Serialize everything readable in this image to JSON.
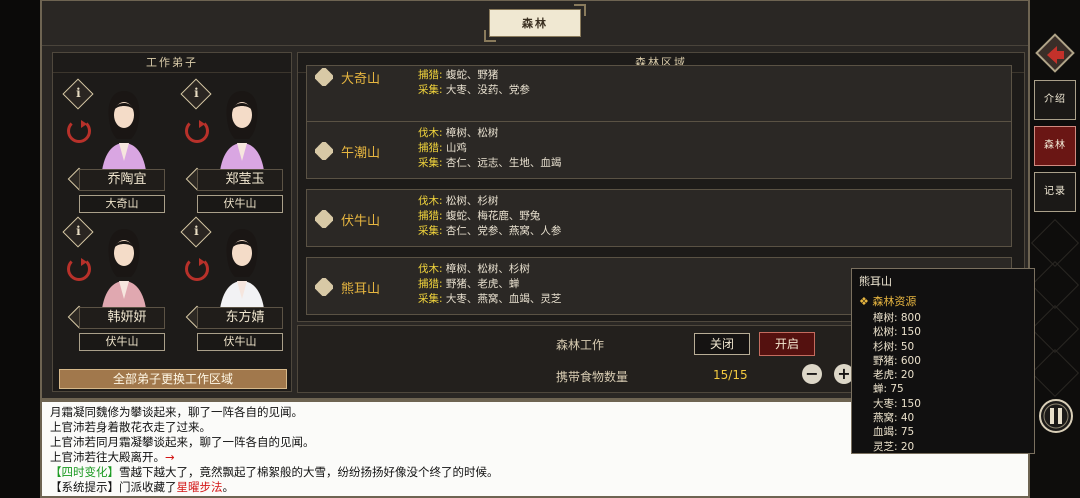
{
  "window": {
    "title": "森林"
  },
  "left_panel": {
    "header": "工作弟子",
    "characters": [
      {
        "name": "乔陶宜",
        "region": "大奇山"
      },
      {
        "name": "郑莹玉",
        "region": "伏牛山"
      },
      {
        "name": "韩妍妍",
        "region": "伏牛山"
      },
      {
        "name": "东方婧",
        "region": "伏牛山"
      }
    ],
    "all_button": "全部弟子更换工作区域"
  },
  "right_panel": {
    "header": "森林区域",
    "areas": [
      {
        "name": "大奇山",
        "rows": [
          {
            "key": "捕猎:",
            "value": "蝮蛇、野猪"
          },
          {
            "key": "采集:",
            "value": "大枣、没药、党参"
          }
        ]
      },
      {
        "name": "午潮山",
        "rows": [
          {
            "key": "伐木:",
            "value": "樟树、松树"
          },
          {
            "key": "捕猎:",
            "value": "山鸡"
          },
          {
            "key": "采集:",
            "value": "杏仁、远志、生地、血竭"
          }
        ]
      },
      {
        "name": "伏牛山",
        "rows": [
          {
            "key": "伐木:",
            "value": "松树、杉树"
          },
          {
            "key": "捕猎:",
            "value": "蝮蛇、梅花鹿、野兔"
          },
          {
            "key": "采集:",
            "value": "杏仁、党参、燕窝、人参"
          }
        ]
      },
      {
        "name": "熊耳山",
        "rows": [
          {
            "key": "伐木:",
            "value": "樟树、松树、杉树"
          },
          {
            "key": "捕猎:",
            "value": "野猪、老虎、蝉"
          },
          {
            "key": "采集:",
            "value": "大枣、燕窝、血竭、灵芝"
          }
        ]
      }
    ]
  },
  "work": {
    "label": "森林工作",
    "close": "关闭",
    "open": "开启",
    "food_label": "携带食物数量",
    "food_count": "15/15",
    "minus": "−",
    "plus": "+"
  },
  "log": [
    {
      "parts": [
        {
          "t": "月霜凝同魏修为攀谈起来，聊了一阵各自的见闻。",
          "c": ""
        }
      ]
    },
    {
      "parts": [
        {
          "t": "上官沛若身着散花衣走了过来。",
          "c": ""
        }
      ]
    },
    {
      "parts": [
        {
          "t": "上官沛若同月霜凝攀谈起来，聊了一阵各自的见闻。",
          "c": ""
        }
      ]
    },
    {
      "parts": [
        {
          "t": "上官沛若往大殿离开。",
          "c": ""
        },
        {
          "t": "→",
          "c": "r"
        }
      ]
    },
    {
      "parts": [
        {
          "t": "【四时变化】",
          "c": "g"
        },
        {
          "t": "雪越下越大了，竟然飘起了棉絮般的大雪，纷纷扬扬好像没个终了的时候。",
          "c": ""
        }
      ]
    },
    {
      "parts": [
        {
          "t": "【系统提示】门派收藏了",
          "c": ""
        },
        {
          "t": "星曜步法",
          "c": "r"
        },
        {
          "t": "。",
          "c": ""
        }
      ]
    }
  ],
  "sidebar": {
    "tabs": [
      "介绍",
      "森林",
      "记录"
    ],
    "active": "森林"
  },
  "tooltip": {
    "title": "熊耳山",
    "subtitle": "森林资源",
    "items": [
      "樟树: 800",
      "松树: 150",
      "杉树: 50",
      "野猪: 600",
      "老虎: 20",
      "蝉: 75",
      "大枣: 150",
      "燕窝: 40",
      "血竭: 75",
      "灵芝: 20"
    ]
  },
  "colors": {
    "accent_gold": "#f1d43c",
    "area_name": "#e7b640",
    "active_tab": "#6a1614",
    "log_green": "#1b9a21",
    "log_red": "#d31616"
  }
}
